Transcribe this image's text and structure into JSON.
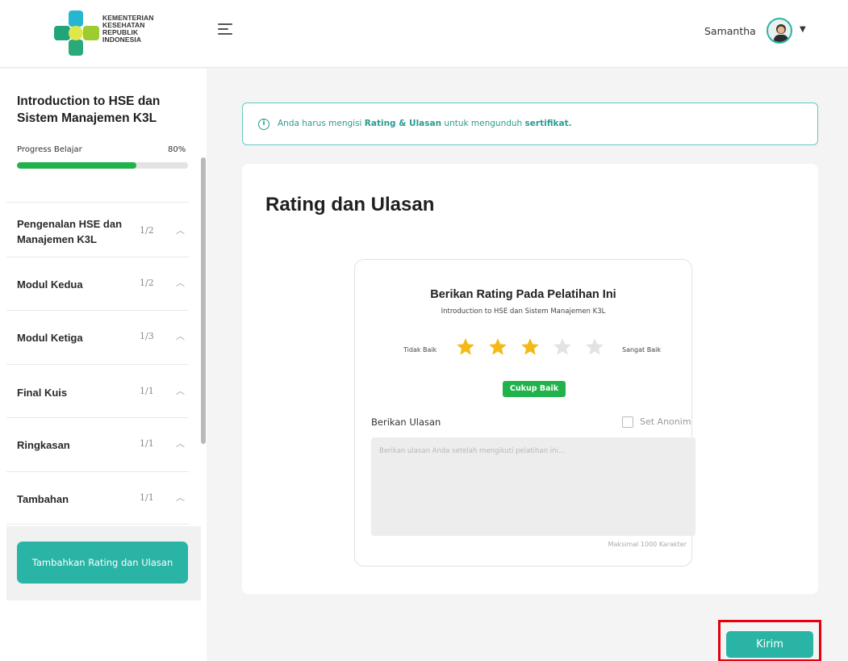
{
  "header": {
    "logo_lines": [
      "KEMENTERIAN",
      "KESEHATAN",
      "REPUBLIK",
      "INDONESIA"
    ],
    "menu_icon": "hamburger-icon",
    "user_name": "Samantha",
    "caret_icon": "caret-down-icon"
  },
  "sidebar": {
    "course_title": "Introduction to HSE dan Sistem Manajemen K3L",
    "progress_label": "Progress Belajar",
    "progress_value": "80%",
    "progress_fraction": 0.7,
    "modules": [
      {
        "label": "Pengenalan HSE dan Manajemen K3L",
        "count": "1/2"
      },
      {
        "label": "Modul Kedua",
        "count": "1/2"
      },
      {
        "label": "Modul Ketiga",
        "count": "1/3"
      },
      {
        "label": "Final Kuis",
        "count": "1/1"
      },
      {
        "label": "Ringkasan",
        "count": "1/1"
      },
      {
        "label": "Tambahan",
        "count": "1/1"
      }
    ],
    "rate_button": "Tambahkan Rating dan Ulasan"
  },
  "alert": {
    "prefix": "Anda harus mengisi ",
    "bold1": "Rating & Ulasan",
    "middle": " untuk mengunduh ",
    "bold2": "sertifikat."
  },
  "main": {
    "page_title": "Rating dan Ulasan",
    "rating_card": {
      "title": "Berikan Rating Pada Pelatihan Ini",
      "subtitle": "Introduction to HSE dan Sistem Manajemen K3L",
      "low_label": "Tidak Baik",
      "high_label": "Sangat Baik",
      "rating": 3,
      "max_rating": 5,
      "rating_badge": "Cukup Baik",
      "review_label": "Berikan Ulasan",
      "anon_label": "Set Anonim",
      "review_placeholder": "Berikan ulasan Anda setelah mengikuti pelatihan ini...",
      "max_label": "Maksimal 1000 Karakter"
    },
    "submit_label": "Kirim"
  },
  "colors": {
    "primary": "#2ab4a5",
    "progress": "#22b24c",
    "star_active": "#f5b914",
    "star_inactive": "#e3e3e3",
    "highlight_border": "#e3000f"
  }
}
